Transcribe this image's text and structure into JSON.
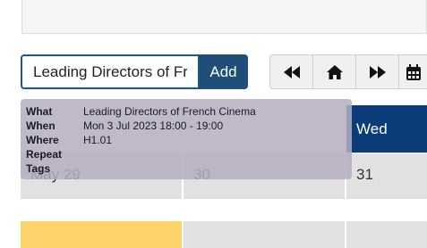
{
  "quick_add": {
    "value": "Leading Directors of Fren",
    "add_label": "Add"
  },
  "nav": {
    "buttons": [
      {
        "name": "previous-icon"
      },
      {
        "name": "home-icon"
      },
      {
        "name": "next-icon"
      },
      {
        "name": "calendar-icon"
      }
    ]
  },
  "calendar": {
    "day_header": "Wed",
    "cells": [
      {
        "label": "May 29"
      },
      {
        "label": "30"
      },
      {
        "label": "31"
      }
    ]
  },
  "tooltip": {
    "what_label": "What",
    "what_value": "Leading Directors of French Cinema",
    "when_label": "When",
    "when_value": "Mon 3 Jul 2023 18:00 - 19:00",
    "where_label": "Where",
    "where_value": "H1.01",
    "repeat_label": "Repeat",
    "repeat_value": "",
    "tags_label": "Tags",
    "tags_value": ""
  },
  "colors": {
    "accent": "#1f4e79",
    "header": "#0b3c78",
    "highlight_day": "#fcd46a",
    "cell": "#e1e1e1"
  }
}
